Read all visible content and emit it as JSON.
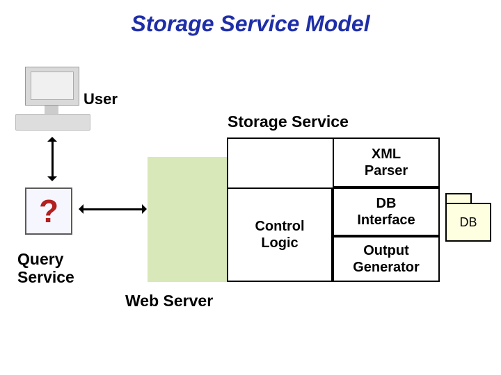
{
  "title": "Storage Service Model",
  "labels": {
    "user": "User",
    "storage_service": "Storage Service",
    "query_service": "Query\nService",
    "web_server": "Web Server"
  },
  "storage_box": {
    "xml_parser": "XML\nParser",
    "control_logic": "Control\nLogic",
    "db_interface": "DB\nInterface",
    "output_generator": "Output\nGenerator"
  },
  "db": {
    "label": "DB"
  },
  "icons": {
    "question": "?"
  }
}
